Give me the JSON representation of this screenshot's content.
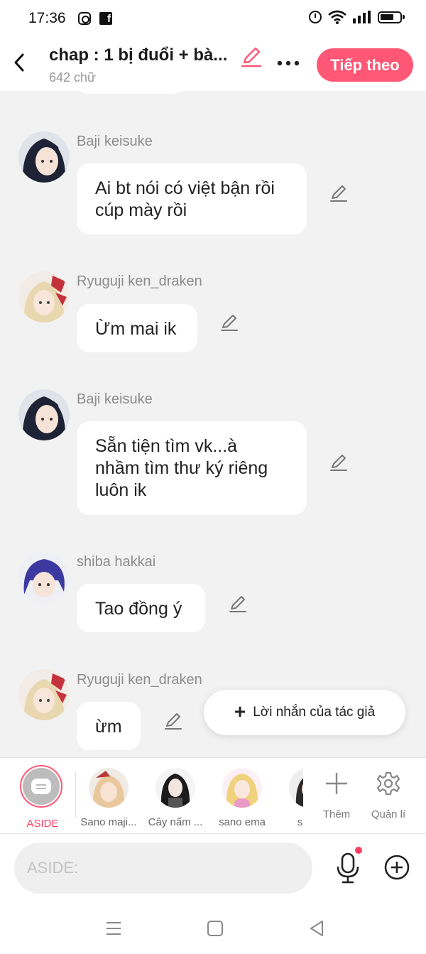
{
  "status_bar": {
    "time": "17:36"
  },
  "header": {
    "title": "chap : 1 bị đuổi + bà...",
    "word_count": "642 chữ",
    "next_label": "Tiếp theo"
  },
  "messages": [
    {
      "name": "Baji keisuke",
      "text_lines": [
        "Ai bt nói có việt bận rồi",
        "cúp mày rồi"
      ]
    },
    {
      "name": "Ryuguji ken_draken",
      "text_lines": [
        "Ừm mai ik"
      ]
    },
    {
      "name": "Baji keisuke",
      "text_lines": [
        "Sẵn tiện tìm vk...à",
        "nhầm tìm thư ký riêng",
        "luôn ik"
      ]
    },
    {
      "name": "shiba hakkai",
      "text_lines": [
        "Tao đồng ý"
      ]
    },
    {
      "name": "Ryuguji ken_draken",
      "text_lines": [
        "ừm"
      ]
    }
  ],
  "author_note_label": "Lời nhắn của tác giả",
  "characters": {
    "aside_label": "ASIDE",
    "items": [
      {
        "label": "Sano maji..."
      },
      {
        "label": "Cây nấm ..."
      },
      {
        "label": "sano ema"
      },
      {
        "label": "sano"
      }
    ],
    "add_label": "Thêm",
    "manage_label": "Quản lí"
  },
  "input": {
    "placeholder": "ASIDE:"
  },
  "colors": {
    "accent": "#ff5775",
    "background": "#f2f2f2"
  }
}
